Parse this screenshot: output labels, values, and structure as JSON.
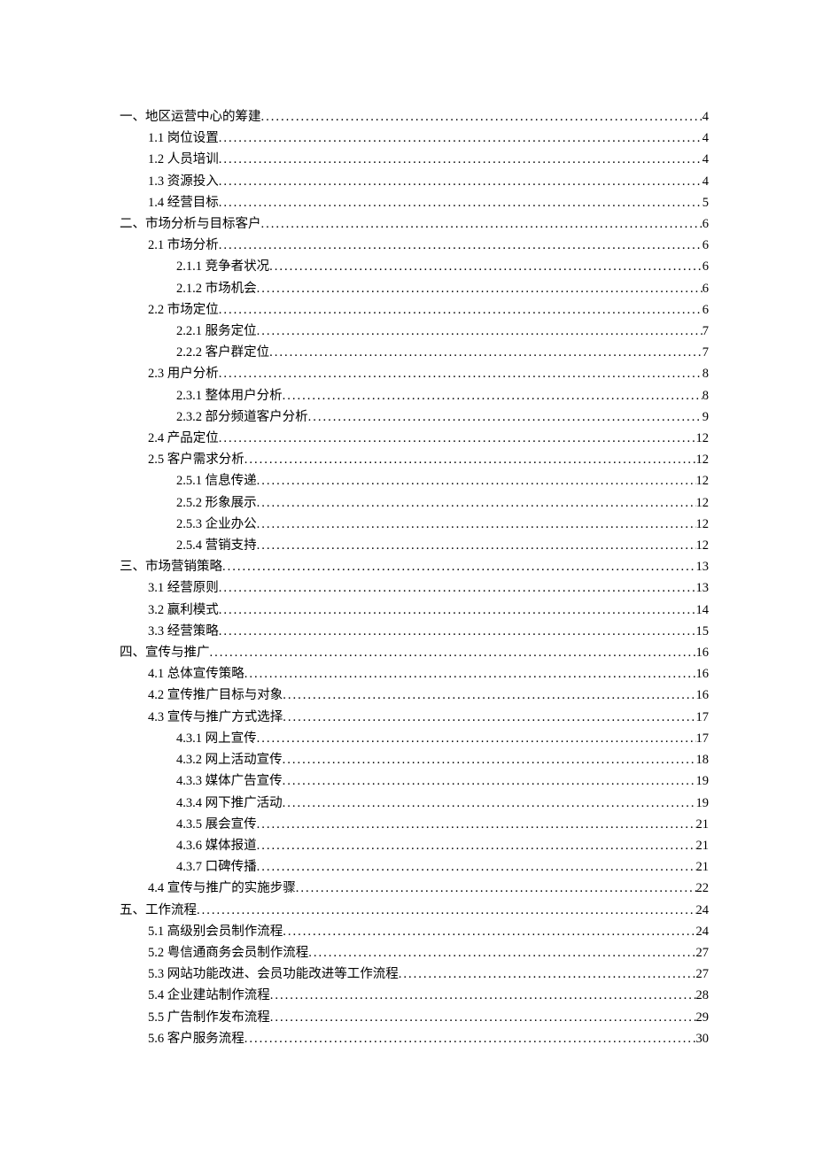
{
  "toc": [
    {
      "label": "一、地区运营中心的筹建",
      "page": "4",
      "indent": 0
    },
    {
      "label": "1.1 岗位设置",
      "page": "4",
      "indent": 1
    },
    {
      "label": "1.2 人员培训",
      "page": "4",
      "indent": 1
    },
    {
      "label": "1.3 资源投入",
      "page": "4",
      "indent": 1
    },
    {
      "label": "1.4 经营目标",
      "page": "5",
      "indent": 1
    },
    {
      "label": "二、市场分析与目标客户",
      "page": "6",
      "indent": 0
    },
    {
      "label": "2.1 市场分析",
      "page": "6",
      "indent": 1
    },
    {
      "label": "2.1.1 竞争者状况",
      "page": "6",
      "indent": 2
    },
    {
      "label": "2.1.2 市场机会",
      "page": "6",
      "indent": 2
    },
    {
      "label": "2.2 市场定位",
      "page": "6",
      "indent": 1
    },
    {
      "label": "2.2.1 服务定位",
      "page": "7",
      "indent": 2
    },
    {
      "label": "2.2.2 客户群定位",
      "page": "7",
      "indent": 2
    },
    {
      "label": "2.3 用户分析",
      "page": "8",
      "indent": 1
    },
    {
      "label": "2.3.1 整体用户分析",
      "page": "8",
      "indent": 2
    },
    {
      "label": "2.3.2 部分频道客户分析",
      "page": "9",
      "indent": 2
    },
    {
      "label": "2.4 产品定位",
      "page": "12",
      "indent": 1
    },
    {
      "label": "2.5 客户需求分析",
      "page": "12",
      "indent": 1
    },
    {
      "label": "2.5.1 信息传递",
      "page": "12",
      "indent": 2
    },
    {
      "label": "2.5.2 形象展示",
      "page": "12",
      "indent": 2
    },
    {
      "label": "2.5.3 企业办公",
      "page": "12",
      "indent": 2
    },
    {
      "label": "2.5.4 营销支持",
      "page": "12",
      "indent": 2
    },
    {
      "label": "三、市场营销策略",
      "page": "13",
      "indent": 0
    },
    {
      "label": "3.1 经营原则",
      "page": "13",
      "indent": 1
    },
    {
      "label": "3.2 赢利模式",
      "page": "14",
      "indent": 1
    },
    {
      "label": "3.3 经营策略",
      "page": "15",
      "indent": 1
    },
    {
      "label": "四、宣传与推广",
      "page": "16",
      "indent": 0
    },
    {
      "label": "4.1 总体宣传策略",
      "page": "16",
      "indent": 1
    },
    {
      "label": "4.2 宣传推广目标与对象",
      "page": "16",
      "indent": 1
    },
    {
      "label": "4.3 宣传与推广方式选择",
      "page": "17",
      "indent": 1
    },
    {
      "label": "4.3.1 网上宣传",
      "page": "17",
      "indent": 2
    },
    {
      "label": "4.3.2 网上活动宣传",
      "page": "18",
      "indent": 2
    },
    {
      "label": "4.3.3 媒体广告宣传",
      "page": "19",
      "indent": 2
    },
    {
      "label": "4.3.4 网下推广活动",
      "page": "19",
      "indent": 2
    },
    {
      "label": "4.3.5 展会宣传",
      "page": "21",
      "indent": 2
    },
    {
      "label": "4.3.6 媒体报道",
      "page": "21",
      "indent": 2
    },
    {
      "label": "4.3.7 口碑传播",
      "page": "21",
      "indent": 2
    },
    {
      "label": "4.4 宣传与推广的实施步骤",
      "page": "22",
      "indent": 1
    },
    {
      "label": "五、工作流程",
      "page": "24",
      "indent": 0
    },
    {
      "label": "5.1 高级别会员制作流程",
      "page": "24",
      "indent": 1
    },
    {
      "label": "5.2 粤信通商务会员制作流程",
      "page": "27",
      "indent": 1
    },
    {
      "label": "5.3 网站功能改进、会员功能改进等工作流程",
      "page": "27",
      "indent": 1
    },
    {
      "label": "5.4 企业建站制作流程",
      "page": "28",
      "indent": 1
    },
    {
      "label": "5.5 广告制作发布流程",
      "page": "29",
      "indent": 1
    },
    {
      "label": "5.6 客户服务流程",
      "page": "30",
      "indent": 1
    }
  ]
}
